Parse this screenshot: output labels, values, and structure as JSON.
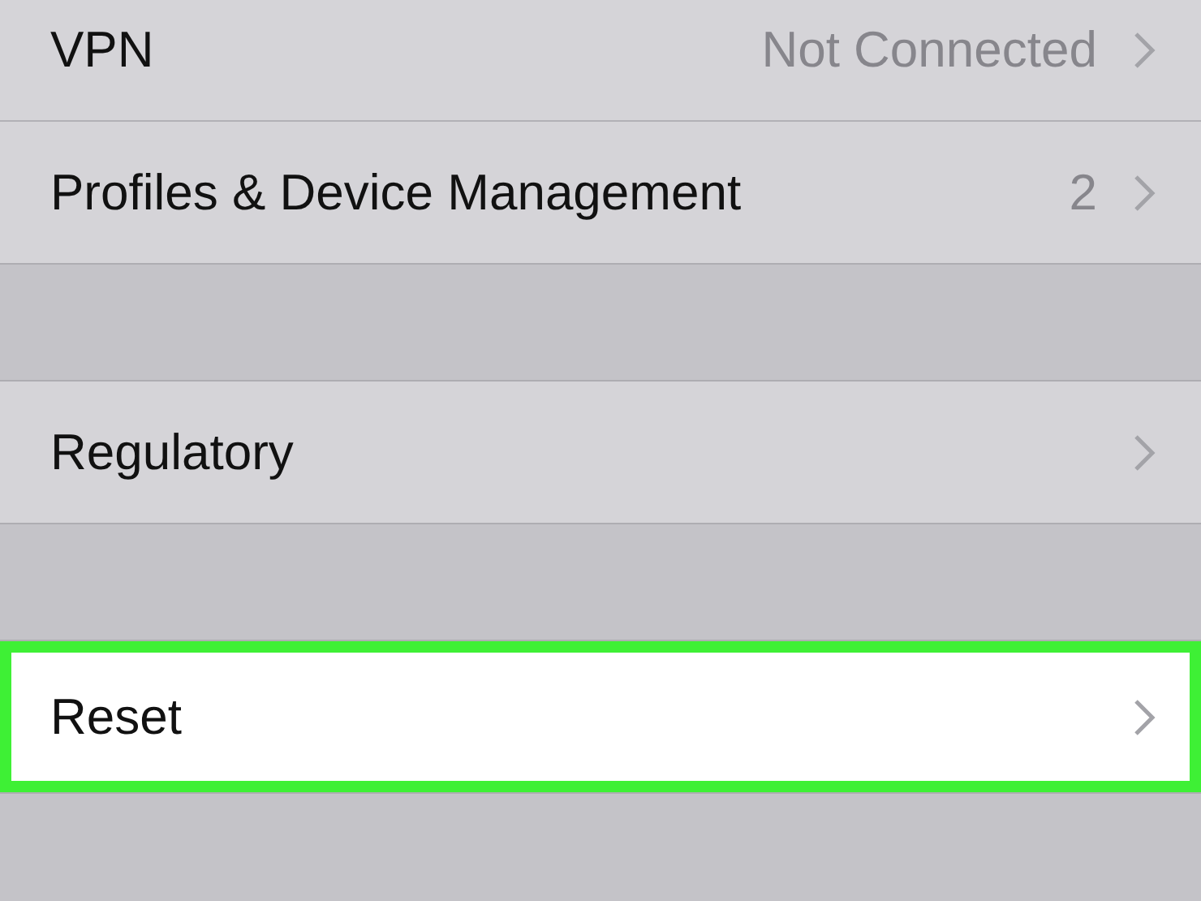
{
  "groups": [
    {
      "rows": [
        {
          "label": "VPN",
          "detail": "Not Connected",
          "highlighted": false
        },
        {
          "label": "Profiles & Device Management",
          "detail": "2",
          "highlighted": false
        }
      ]
    },
    {
      "rows": [
        {
          "label": "Regulatory",
          "highlighted": false
        }
      ]
    },
    {
      "rows": [
        {
          "label": "Reset",
          "highlighted": true
        }
      ]
    }
  ]
}
